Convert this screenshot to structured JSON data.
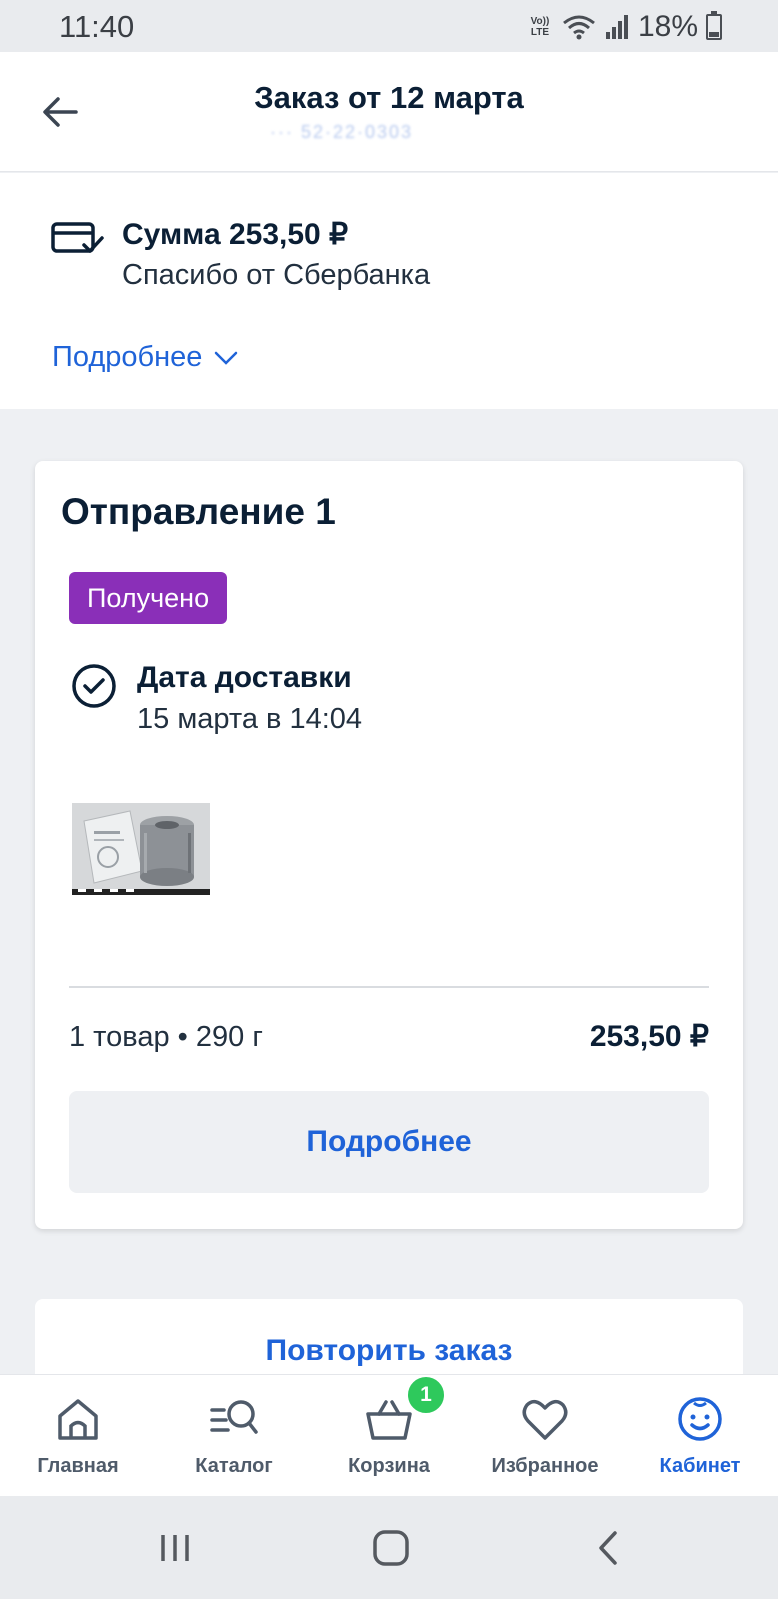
{
  "status_bar": {
    "time": "11:40",
    "network_label_top": "Vo))",
    "network_label_bottom": "LTE",
    "battery": "18%"
  },
  "header": {
    "title": "Заказ от 12 марта",
    "subtitle": "··· 52·22·0303"
  },
  "summary": {
    "sum": "Сумма 253,50 ₽",
    "payment": "Спасибо от Сбербанка",
    "more_link": "Подробнее"
  },
  "shipment": {
    "title": "Отправление 1",
    "status": "Получено",
    "status_color": "#8a2fb8",
    "delivery_label": "Дата доставки",
    "delivery_date": "15 марта в 14:04",
    "items_info": "1 товар • 290 г",
    "price": "253,50 ₽",
    "details_button": "Подробнее"
  },
  "repeat_order": "Повторить заказ",
  "tabbar": {
    "items": [
      {
        "label": "Главная",
        "icon": "home-icon"
      },
      {
        "label": "Каталог",
        "icon": "catalog-search-icon"
      },
      {
        "label": "Корзина",
        "icon": "basket-icon",
        "badge": "1"
      },
      {
        "label": "Избранное",
        "icon": "heart-icon"
      },
      {
        "label": "Кабинет",
        "icon": "smiley-profile-icon",
        "active": true
      }
    ]
  },
  "colors": {
    "accent": "#1f63d8",
    "badge_green": "#2ec95c",
    "text_dark": "#0b1f35"
  }
}
